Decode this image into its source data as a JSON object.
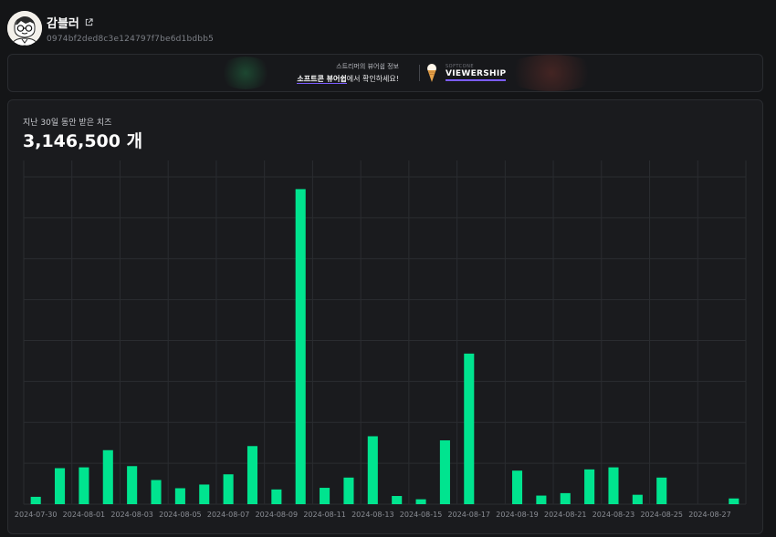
{
  "profile": {
    "name": "감블러",
    "hash": "0974bf2ded8c3e124797f7be6d1bdbb5"
  },
  "banner": {
    "line1": "스트리머의 뷰어쉽 정보",
    "line2_highlight": "소프트콘 뷰어쉽",
    "line2_rest": "에서 확인하세요!",
    "logo_small": "SOFTCONE",
    "logo_big": "VIEWERSHIP"
  },
  "card": {
    "title": "지난 30일 동안 받은 치즈",
    "total": "3,146,500 개"
  },
  "chart_data": {
    "type": "bar",
    "color": "#00e48f",
    "x": [
      "2024-07-30",
      "2024-07-31",
      "2024-08-01",
      "2024-08-02",
      "2024-08-03",
      "2024-08-04",
      "2024-08-05",
      "2024-08-06",
      "2024-08-07",
      "2024-08-08",
      "2024-08-09",
      "2024-08-10",
      "2024-08-11",
      "2024-08-12",
      "2024-08-13",
      "2024-08-14",
      "2024-08-15",
      "2024-08-16",
      "2024-08-17",
      "2024-08-18",
      "2024-08-19",
      "2024-08-20",
      "2024-08-21",
      "2024-08-22",
      "2024-08-23",
      "2024-08-24",
      "2024-08-25",
      "2024-08-26",
      "2024-08-27",
      "2024-08-28"
    ],
    "tick_labels": [
      "2024-07-30",
      "2024-08-01",
      "2024-08-03",
      "2024-08-05",
      "2024-08-07",
      "2024-08-09",
      "2024-08-11",
      "2024-08-13",
      "2024-08-15",
      "2024-08-17",
      "2024-08-19",
      "2024-08-21",
      "2024-08-23",
      "2024-08-25",
      "2024-08-27"
    ],
    "values": [
      18000,
      88000,
      90000,
      132000,
      93000,
      59000,
      39000,
      48000,
      73000,
      142000,
      36000,
      770000,
      40000,
      65000,
      166000,
      20000,
      12000,
      156000,
      368000,
      0,
      82000,
      21000,
      27000,
      85000,
      90000,
      23000,
      65000,
      0,
      0,
      14000
    ],
    "ylim": [
      0,
      840000
    ],
    "grid": true
  }
}
